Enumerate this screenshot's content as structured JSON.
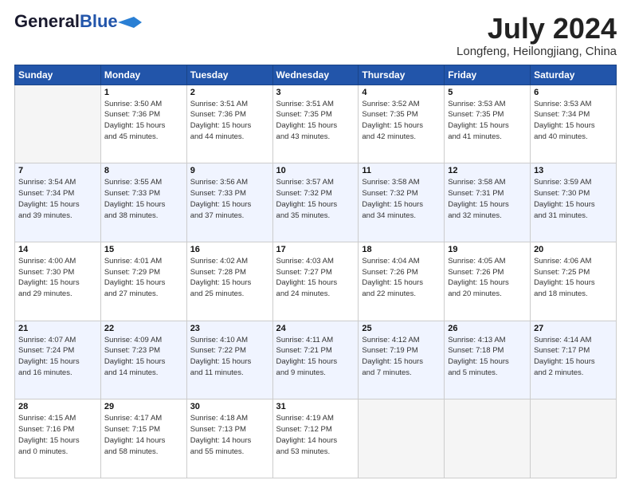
{
  "header": {
    "logo_line1": "General",
    "logo_line2": "Blue",
    "title": "July 2024",
    "subtitle": "Longfeng, Heilongjiang, China"
  },
  "days_of_week": [
    "Sunday",
    "Monday",
    "Tuesday",
    "Wednesday",
    "Thursday",
    "Friday",
    "Saturday"
  ],
  "weeks": [
    [
      {
        "day": "",
        "info": ""
      },
      {
        "day": "1",
        "info": "Sunrise: 3:50 AM\nSunset: 7:36 PM\nDaylight: 15 hours\nand 45 minutes."
      },
      {
        "day": "2",
        "info": "Sunrise: 3:51 AM\nSunset: 7:36 PM\nDaylight: 15 hours\nand 44 minutes."
      },
      {
        "day": "3",
        "info": "Sunrise: 3:51 AM\nSunset: 7:35 PM\nDaylight: 15 hours\nand 43 minutes."
      },
      {
        "day": "4",
        "info": "Sunrise: 3:52 AM\nSunset: 7:35 PM\nDaylight: 15 hours\nand 42 minutes."
      },
      {
        "day": "5",
        "info": "Sunrise: 3:53 AM\nSunset: 7:35 PM\nDaylight: 15 hours\nand 41 minutes."
      },
      {
        "day": "6",
        "info": "Sunrise: 3:53 AM\nSunset: 7:34 PM\nDaylight: 15 hours\nand 40 minutes."
      }
    ],
    [
      {
        "day": "7",
        "info": "Sunrise: 3:54 AM\nSunset: 7:34 PM\nDaylight: 15 hours\nand 39 minutes."
      },
      {
        "day": "8",
        "info": "Sunrise: 3:55 AM\nSunset: 7:33 PM\nDaylight: 15 hours\nand 38 minutes."
      },
      {
        "day": "9",
        "info": "Sunrise: 3:56 AM\nSunset: 7:33 PM\nDaylight: 15 hours\nand 37 minutes."
      },
      {
        "day": "10",
        "info": "Sunrise: 3:57 AM\nSunset: 7:32 PM\nDaylight: 15 hours\nand 35 minutes."
      },
      {
        "day": "11",
        "info": "Sunrise: 3:58 AM\nSunset: 7:32 PM\nDaylight: 15 hours\nand 34 minutes."
      },
      {
        "day": "12",
        "info": "Sunrise: 3:58 AM\nSunset: 7:31 PM\nDaylight: 15 hours\nand 32 minutes."
      },
      {
        "day": "13",
        "info": "Sunrise: 3:59 AM\nSunset: 7:30 PM\nDaylight: 15 hours\nand 31 minutes."
      }
    ],
    [
      {
        "day": "14",
        "info": "Sunrise: 4:00 AM\nSunset: 7:30 PM\nDaylight: 15 hours\nand 29 minutes."
      },
      {
        "day": "15",
        "info": "Sunrise: 4:01 AM\nSunset: 7:29 PM\nDaylight: 15 hours\nand 27 minutes."
      },
      {
        "day": "16",
        "info": "Sunrise: 4:02 AM\nSunset: 7:28 PM\nDaylight: 15 hours\nand 25 minutes."
      },
      {
        "day": "17",
        "info": "Sunrise: 4:03 AM\nSunset: 7:27 PM\nDaylight: 15 hours\nand 24 minutes."
      },
      {
        "day": "18",
        "info": "Sunrise: 4:04 AM\nSunset: 7:26 PM\nDaylight: 15 hours\nand 22 minutes."
      },
      {
        "day": "19",
        "info": "Sunrise: 4:05 AM\nSunset: 7:26 PM\nDaylight: 15 hours\nand 20 minutes."
      },
      {
        "day": "20",
        "info": "Sunrise: 4:06 AM\nSunset: 7:25 PM\nDaylight: 15 hours\nand 18 minutes."
      }
    ],
    [
      {
        "day": "21",
        "info": "Sunrise: 4:07 AM\nSunset: 7:24 PM\nDaylight: 15 hours\nand 16 minutes."
      },
      {
        "day": "22",
        "info": "Sunrise: 4:09 AM\nSunset: 7:23 PM\nDaylight: 15 hours\nand 14 minutes."
      },
      {
        "day": "23",
        "info": "Sunrise: 4:10 AM\nSunset: 7:22 PM\nDaylight: 15 hours\nand 11 minutes."
      },
      {
        "day": "24",
        "info": "Sunrise: 4:11 AM\nSunset: 7:21 PM\nDaylight: 15 hours\nand 9 minutes."
      },
      {
        "day": "25",
        "info": "Sunrise: 4:12 AM\nSunset: 7:19 PM\nDaylight: 15 hours\nand 7 minutes."
      },
      {
        "day": "26",
        "info": "Sunrise: 4:13 AM\nSunset: 7:18 PM\nDaylight: 15 hours\nand 5 minutes."
      },
      {
        "day": "27",
        "info": "Sunrise: 4:14 AM\nSunset: 7:17 PM\nDaylight: 15 hours\nand 2 minutes."
      }
    ],
    [
      {
        "day": "28",
        "info": "Sunrise: 4:15 AM\nSunset: 7:16 PM\nDaylight: 15 hours\nand 0 minutes."
      },
      {
        "day": "29",
        "info": "Sunrise: 4:17 AM\nSunset: 7:15 PM\nDaylight: 14 hours\nand 58 minutes."
      },
      {
        "day": "30",
        "info": "Sunrise: 4:18 AM\nSunset: 7:13 PM\nDaylight: 14 hours\nand 55 minutes."
      },
      {
        "day": "31",
        "info": "Sunrise: 4:19 AM\nSunset: 7:12 PM\nDaylight: 14 hours\nand 53 minutes."
      },
      {
        "day": "",
        "info": ""
      },
      {
        "day": "",
        "info": ""
      },
      {
        "day": "",
        "info": ""
      }
    ]
  ]
}
